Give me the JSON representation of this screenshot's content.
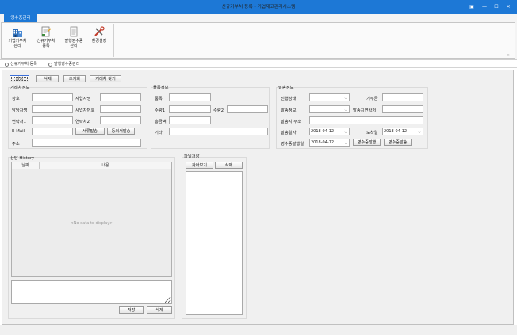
{
  "window": {
    "title": "신규기부처 등록 - 기업재고관리시스템",
    "controls": {
      "pin": "▣",
      "minimize": "—",
      "maximize": "☐",
      "close": "✕"
    }
  },
  "ribbon": {
    "tab_label": "영수증관리",
    "buttons": [
      {
        "line1": "기업기부처",
        "line2": "관리",
        "icon": "building-icon"
      },
      {
        "line1": "신규기부처",
        "line2": "등록",
        "icon": "document-edit-icon"
      },
      {
        "line1": "발행영수증",
        "line2": "관리",
        "icon": "receipt-icon"
      },
      {
        "line1": "환경설정",
        "line2": "",
        "icon": "tools-icon"
      }
    ],
    "collapse_glyph": "«"
  },
  "doc_tabs": [
    {
      "label": "신규기부처 등록",
      "active": true
    },
    {
      "label": "발행영수증관리",
      "active": false
    }
  ],
  "toolbar": {
    "save": "저장",
    "delete": "삭제",
    "reset": "초기화",
    "find_partner": "거래처 찾기"
  },
  "partner_info": {
    "title": "거래처정보",
    "trade_name_label": "상호",
    "business_name_label": "사업자명",
    "manager_label": "담당자명",
    "business_number_label": "사업자번호",
    "contact1_label": "연락처1",
    "contact2_label": "연락처2",
    "email_label": "E-Mail",
    "send_docs_button": "서류발송",
    "consent_button": "동의서발송",
    "address_label": "주소"
  },
  "item_info": {
    "title": "물품정보",
    "item_label": "품목",
    "qty1_label": "수량1",
    "qty2_label": "수량2",
    "total_label": "총금액",
    "etc_label": "기타"
  },
  "shipping_info": {
    "title": "발송정보",
    "status_label": "진행상태",
    "donation_label": "기부금",
    "ship_info_label": "발송정보",
    "ship_contact_label": "발송지연락처",
    "ship_address_label": "발송지 주소",
    "ship_date_label": "발송일자",
    "ship_date_value": "2018-04-12",
    "arrival_label": "도착일",
    "arrival_value": "2018-04-12",
    "receipt_date_label": "영수증발행일",
    "receipt_date_value": "2018-04-12",
    "receipt_issue_button": "영수증발행",
    "receipt_send_button": "영수증발송"
  },
  "history": {
    "title": "상담 History",
    "columns": [
      "날짜",
      "내용"
    ],
    "empty_text": "<No data to display>",
    "save": "저장",
    "delete": "삭제"
  },
  "files": {
    "title": "파일저장",
    "browse": "찾아보기",
    "delete": "삭제"
  }
}
